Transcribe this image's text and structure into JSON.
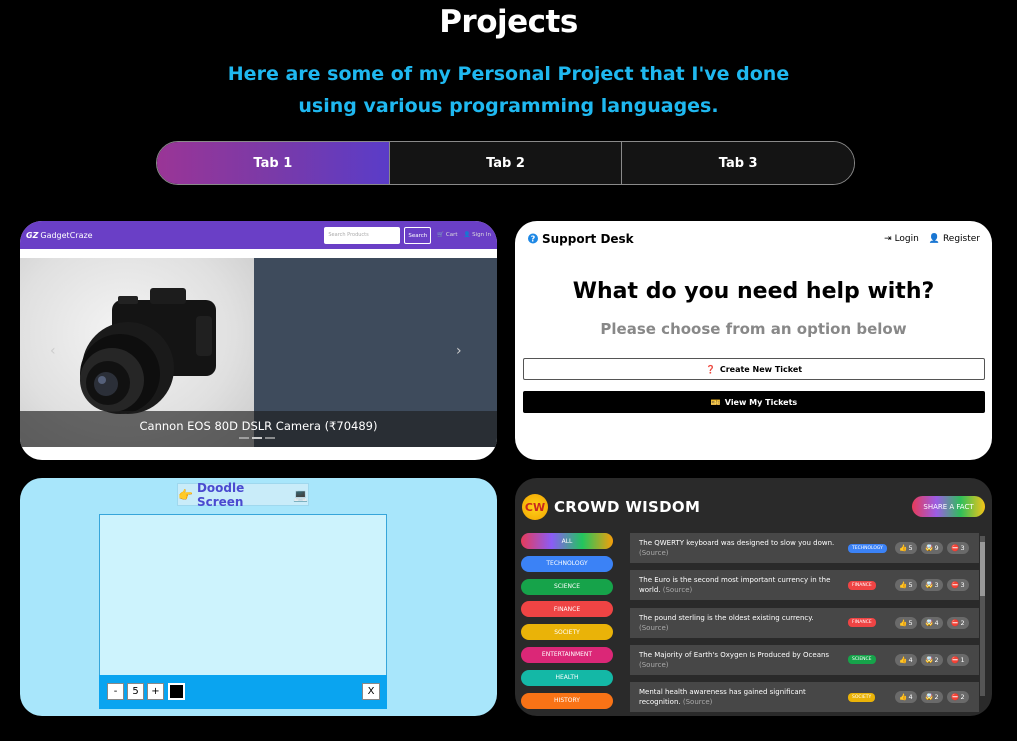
{
  "header": {
    "title": "Projects",
    "subtitle_line1": "Here are some of my Personal Project that I've done",
    "subtitle_line2": "using various programming languages."
  },
  "tabs": [
    {
      "label": "Tab 1",
      "active": true
    },
    {
      "label": "Tab 2",
      "active": false
    },
    {
      "label": "Tab 3",
      "active": false
    }
  ],
  "gadgetcraze": {
    "brand": "GadgetCraze",
    "search_placeholder": "Search Products",
    "search_button": "Search",
    "cart": "Cart",
    "signin": "Sign In",
    "caption": "Cannon EOS 80D DSLR Camera (₹70489)",
    "prev": "‹",
    "next": "›"
  },
  "support_desk": {
    "brand": "Support Desk",
    "login": "Login",
    "register": "Register",
    "heading": "What do you need help with?",
    "subheading": "Please choose from an option below",
    "create_ticket": "Create New Ticket",
    "view_tickets": "View My Tickets"
  },
  "doodle": {
    "title": "Doodle Screen",
    "minus": "-",
    "size": "5",
    "plus": "+",
    "clear": "X",
    "color": "#000000"
  },
  "crowd_wisdom": {
    "logo": "CW",
    "title": "CROWD WISDOM",
    "share": "SHARE A FACT",
    "categories": [
      {
        "label": "ALL",
        "color": "linear-gradient(90deg,#e63b5a,#8b5cf6,#22c55e,#f59e0b)"
      },
      {
        "label": "TECHNOLOGY",
        "color": "#3b82f6"
      },
      {
        "label": "SCIENCE",
        "color": "#16a34a"
      },
      {
        "label": "FINANCE",
        "color": "#ef4444"
      },
      {
        "label": "SOCIETY",
        "color": "#eab308"
      },
      {
        "label": "ENTERTAINMENT",
        "color": "#db2777"
      },
      {
        "label": "HEALTH",
        "color": "#14b8a6"
      },
      {
        "label": "HISTORY",
        "color": "#f97316"
      }
    ],
    "facts": [
      {
        "text": "The QWERTY keyboard was designed to slow you down.",
        "source": "(Source)",
        "tag": "TECHNOLOGY",
        "tag_color": "#3b82f6",
        "up": "5",
        "mind": "9",
        "down": "3"
      },
      {
        "text": "The Euro is the second most important currency in the world.",
        "source": "(Source)",
        "tag": "FINANCE",
        "tag_color": "#ef4444",
        "up": "5",
        "mind": "3",
        "down": "3"
      },
      {
        "text": "The pound sterling is the oldest existing currency.",
        "source": "(Source)",
        "tag": "FINANCE",
        "tag_color": "#ef4444",
        "up": "5",
        "mind": "4",
        "down": "2"
      },
      {
        "text": "The Majority of Earth's Oxygen Is Produced by Oceans",
        "source": "(Source)",
        "tag": "SCIENCE",
        "tag_color": "#16a34a",
        "up": "4",
        "mind": "2",
        "down": "1"
      },
      {
        "text": "Mental health awareness has gained significant recognition.",
        "source": "(Source)",
        "tag": "SOCIETY",
        "tag_color": "#eab308",
        "up": "4",
        "mind": "2",
        "down": "2"
      }
    ]
  }
}
